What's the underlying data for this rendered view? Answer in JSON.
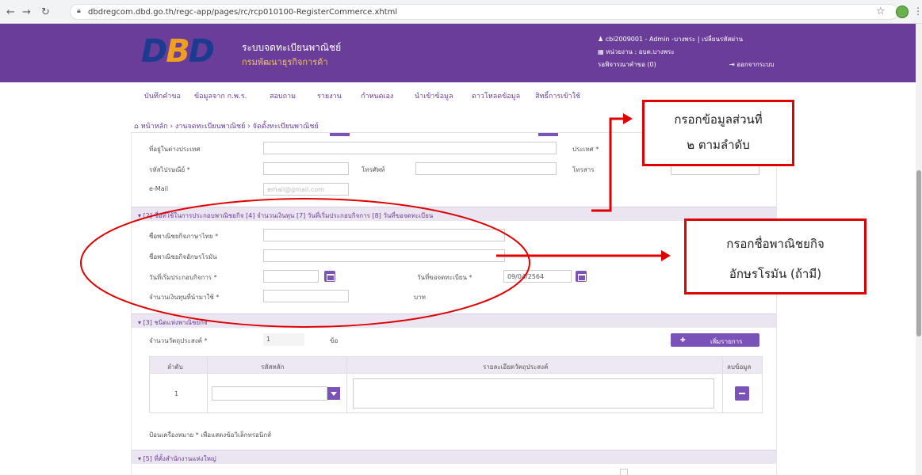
{
  "browser": {
    "url": "dbdregcom.dbd.go.th/regc-app/pages/rc/rcp010100-RegisterCommerce.xhtml"
  },
  "header": {
    "logo_d": "D",
    "logo_b": "B",
    "logo_d2": "D",
    "system_title": "ระบบจดทะเบียนพาณิชย์",
    "system_subtitle": "กรมพัฒนาธุรกิจการค้า",
    "user": "cbi2009001 - Admin -บางพระ  |  เปลี่ยนรหัสผ่าน",
    "department": "หน่วยงาน : อบต.บางพระ",
    "pending": "รอพิจารณาคำขอ (0)",
    "logout": "ออกจากระบบ"
  },
  "menu": {
    "items": [
      "บันทึกคำขอ",
      "ข้อมูลจาก ก.พ.ร.",
      "สอบถาม",
      "รายงาน",
      "กำหนดเอง",
      "นำเข้าข้อมูล",
      "ดาวโหลดข้อมูล",
      "สิทธิ์การเข้าใช้"
    ]
  },
  "breadcrumb": "หน้าหลัก › งานจดทะเบียนพาณิชย์ › จัดตั้งทะเบียนพาณิชย์",
  "form": {
    "foreign_address_label": "ที่อยู่ในต่างประเทศ",
    "country_label": "ประเทศ *",
    "postal_label": "รหัสไปรษณีย์ *",
    "phone_label": "โทรศัพท์",
    "fax_label": "โทรสาร",
    "email_label": "e-Mail",
    "email_placeholder": "email@gmail.com",
    "section2": "[2] ชื่อที่ใช้ในการประกอบพาณิชยกิจ [4] จำนวนเงินทุน [7] วันที่เริ่มประกอบกิจการ [8] วันที่ขอจดทะเบียน",
    "thai_name_label": "ชื่อพาณิชยกิจภาษาไทย *",
    "roman_name_label": "ชื่อพาณิชยกิจอักษรโรมัน",
    "start_date_label": "วันที่เริ่มประกอบกิจการ *",
    "reg_date_label": "วันที่ขอจดทะเบียน *",
    "reg_date_value": "09/04/2564",
    "capital_label": "จำนวนเงินทุนที่นำมาใช้ *",
    "baht": "บาท",
    "section3": "[3] ชนิดแห่งพาณิชยกิจ",
    "objective_count_label": "จำนวนวัตถุประสงค์ *",
    "objective_count": "1",
    "item_unit": "ข้อ",
    "add_button": "เพิ่มรายการ",
    "table_headers": [
      "ลำดับ",
      "รหัสหลัก",
      "รายละเอียดวัตถุประสงค์",
      "ลบข้อมูล"
    ],
    "row_index": "1",
    "note": "ป้อนเครื่องหมาย * เพื่อแสดงข้อวิเล็กทรอนิกส์",
    "section5": "[5] ที่ตั้งสำนักงานแห่งใหญ่"
  },
  "annotations": {
    "callout1_line1": "กรอกข้อมูลส่วนที่",
    "callout1_line2": "๒ ตามลำดับ",
    "callout2_line1": "กรอกชื่อพาณิชยกิจ",
    "callout2_line2": "อักษรโรมัน (ถ้ามี)",
    "color": "#e00000"
  },
  "colors": {
    "header_purple": "#6a3d9a",
    "button_purple": "#7b52b8",
    "section_bg": "#ebe5f2"
  },
  "icons": [
    "back-icon",
    "forward-icon",
    "reload-icon",
    "lock-icon",
    "star-icon",
    "profile-icon",
    "menu-kebab-icon",
    "user-icon",
    "building-icon",
    "logout-icon",
    "home-icon",
    "calendar-icon",
    "chevron-down-icon",
    "plus-icon",
    "minus-icon"
  ]
}
